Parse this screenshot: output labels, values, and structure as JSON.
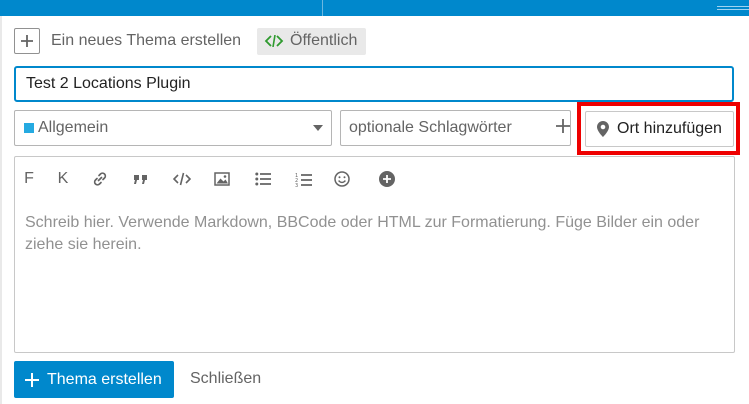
{
  "header": {
    "title": "Ein neues Thema erstellen",
    "visibility_label": "Öffentlich"
  },
  "composer": {
    "title_value": "Test 2 Locations Plugin",
    "category": {
      "label": "Allgemein",
      "color": "#25aae1"
    },
    "tags_placeholder": "optionale Schlagwörter",
    "location_button_label": "Ort hinzufügen",
    "toolbar": {
      "bold_label": "F",
      "italic_label": "K",
      "buttons": [
        "link-icon",
        "quote-icon",
        "code-icon",
        "image-icon",
        "bullet-list-icon",
        "numbered-list-icon",
        "emoji-icon",
        "more-options-icon"
      ]
    },
    "editor_placeholder": "Schreib hier. Verwende Markdown, BBCode oder HTML zur Formatierung. Füge Bilder ein oder ziehe sie herein."
  },
  "footer": {
    "submit_label": "Thema erstellen",
    "close_label": "Schließen"
  },
  "colors": {
    "accent": "#0088cc",
    "highlight": "#ee0000"
  }
}
